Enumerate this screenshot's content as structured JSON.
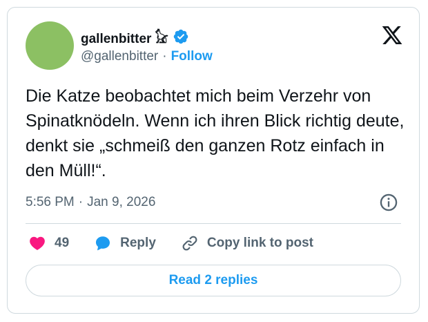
{
  "author": {
    "display_name": "gallenbitter 𓃠",
    "handle": "@gallenbitter",
    "separator": "·",
    "follow_label": "Follow",
    "avatar_color": "#8cc063",
    "verified": true
  },
  "brand": {
    "logo_icon": "x-logo-icon"
  },
  "tweet": {
    "text": "Die Katze beobachtet mich beim Verzehr von Spinatknödeln. Wenn ich ihren Blick richtig deute, denkt sie „schmeiß den ganzen Rotz einfach in den Müll!“.",
    "time": "5:56 PM",
    "separator": "·",
    "date": "Jan 9, 2026"
  },
  "actions": {
    "likes_count": "49",
    "reply_label": "Reply",
    "copy_link_label": "Copy link to post"
  },
  "footer": {
    "read_replies_label": "Read 2 replies"
  },
  "colors": {
    "accent": "#1d9bf0",
    "like": "#f91880",
    "text": "#0f1419",
    "muted": "#536471",
    "border": "#cfd9de"
  }
}
